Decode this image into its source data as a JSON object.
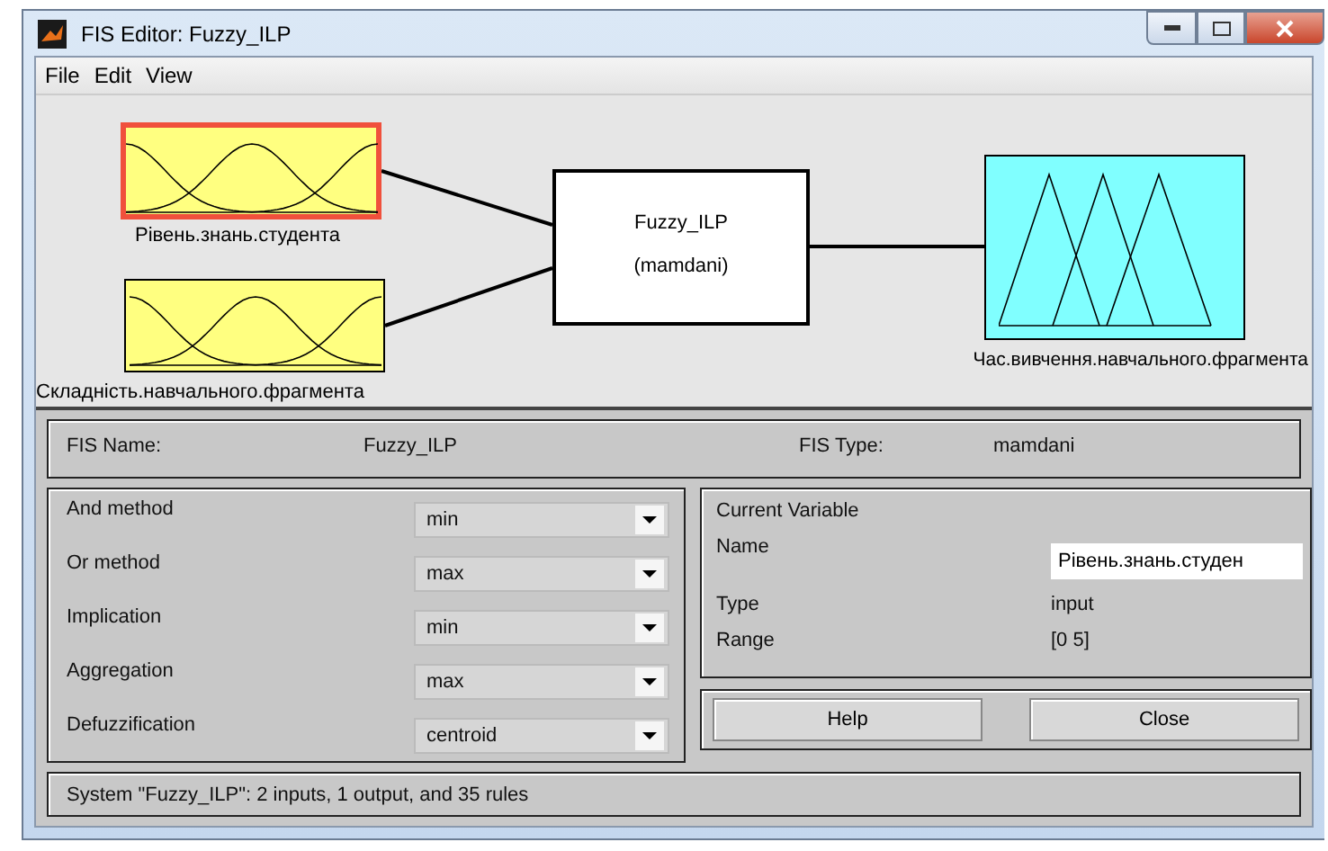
{
  "window": {
    "title": "FIS Editor: Fuzzy_ILP"
  },
  "menu": [
    "File",
    "Edit",
    "View"
  ],
  "diagram": {
    "inputs": [
      {
        "name": "Рівень.знань.студента",
        "selected": true
      },
      {
        "name": "Складність.навчального.фрагмента",
        "selected": false
      }
    ],
    "system": {
      "name": "Fuzzy_ILP",
      "type": "(mamdani)"
    },
    "outputs": [
      {
        "name": "Час.вивчення.навчального.фрагмента",
        "selected": false
      }
    ]
  },
  "fis_info": [
    {
      "label": "FIS Name:",
      "value": "Fuzzy_ILP"
    },
    {
      "label": "FIS Type:",
      "value": "mamdani"
    }
  ],
  "methods": [
    {
      "label": "And method",
      "value": "min"
    },
    {
      "label": "Or method",
      "value": "max"
    },
    {
      "label": "Implication",
      "value": "min"
    },
    {
      "label": "Aggregation",
      "value": "max"
    },
    {
      "label": "Defuzzification",
      "value": "centroid"
    }
  ],
  "current_variable": {
    "title": "Current Variable",
    "name_label": "Name",
    "name_value": "Рівень.знань.студен",
    "type_label": "Type",
    "type_value": "input",
    "range_label": "Range",
    "range_value": "[0 5]"
  },
  "buttons": [
    "Help",
    "Close"
  ],
  "status_bar": "System \"Fuzzy_ILP\": 2 inputs, 1 output, and 35 rules"
}
